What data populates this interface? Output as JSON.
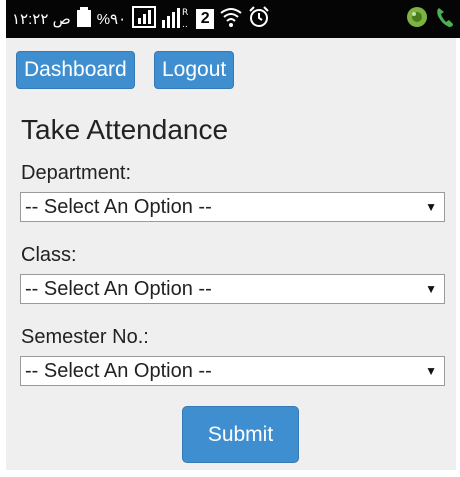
{
  "status_bar": {
    "time": "۱۲:۲۲ ص",
    "battery_percent": "%۹۰",
    "sim_label": "2"
  },
  "nav": {
    "dashboard_label": "Dashboard",
    "logout_label": "Logout"
  },
  "page_title": "Take Attendance",
  "form": {
    "department": {
      "label": "Department:",
      "selected": "-- Select An Option --"
    },
    "class": {
      "label": "Class:",
      "selected": "-- Select An Option --"
    },
    "semester": {
      "label": "Semester No.:",
      "selected": "-- Select An Option --"
    },
    "submit_label": "Submit"
  },
  "colors": {
    "primary_button": "#3f8fd0",
    "page_background": "#efefef",
    "status_bar": "#050505"
  }
}
